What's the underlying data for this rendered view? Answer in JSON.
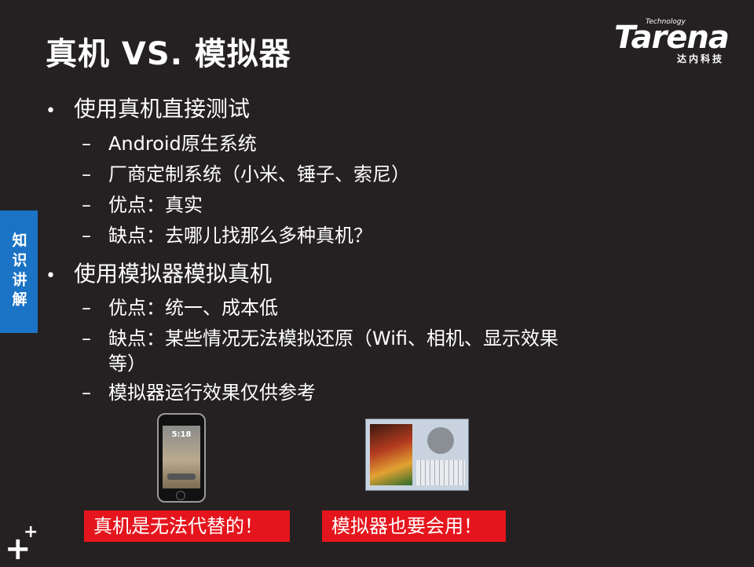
{
  "slide": {
    "title": "真机 VS. 模拟器",
    "side_tab": "知识讲解"
  },
  "logo": {
    "name": "Tarena",
    "tagline": "Technology",
    "cn": "达内科技"
  },
  "bullets": [
    {
      "text": "使用真机直接测试",
      "items": [
        "Android原生系统",
        "厂商定制系统（小米、锤子、索尼）",
        "优点：真实",
        "缺点：去哪儿找那么多种真机？"
      ]
    },
    {
      "text": "使用模拟器模拟真机",
      "items": [
        "优点：统一、成本低",
        "缺点：某些情况无法模拟还原（Wifi、相机、显示效果\n等）",
        "模拟器运行效果仅供参考"
      ]
    }
  ],
  "markers": {
    "bullet": "•",
    "dash": "–"
  },
  "images": {
    "phone_time": "5:18"
  },
  "tags": {
    "real_device": "真机是无法代替的！",
    "emulator": "模拟器也要会用！"
  },
  "corner": {
    "big": "+",
    "small": "+"
  },
  "colors": {
    "background": "#252122",
    "side_tab": "#1a73c4",
    "tag": "#e5151d",
    "text": "#ffffff"
  }
}
